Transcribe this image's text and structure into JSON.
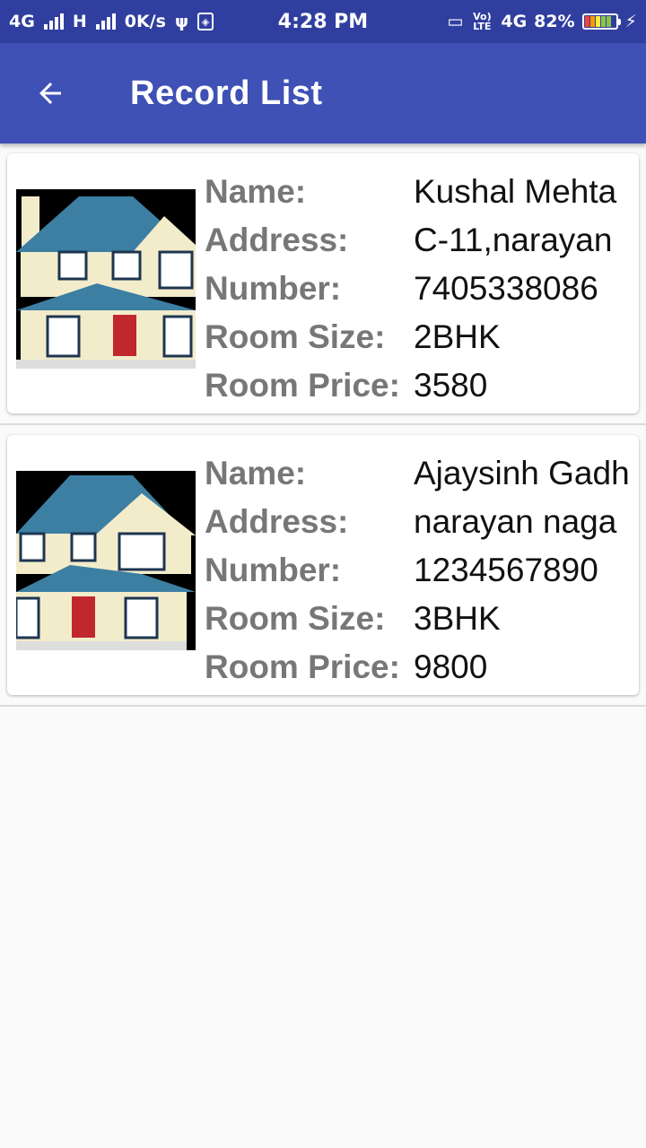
{
  "status_bar": {
    "net1": "4G",
    "net2": "H",
    "speed": "0K/s",
    "time": "4:28 PM",
    "volte": "Vo) LTE",
    "net3": "4G",
    "battery_pct": "82%",
    "battery_level": 0.82
  },
  "app_bar": {
    "title": "Record List",
    "back_icon": "arrow-back-icon"
  },
  "records": [
    {
      "image_icon": "house-image",
      "name_label": "Name:",
      "name": "Kushal Mehta",
      "address_label": "Address:",
      "address": "C-11,narayan",
      "number_label": "Number:",
      "number": "7405338086",
      "room_size_label": "Room Size:",
      "room_size": "2BHK",
      "room_price_label": "Room Price:",
      "room_price": "3580"
    },
    {
      "image_icon": "house-image",
      "name_label": "Name:",
      "name": "Ajaysinh Gadh",
      "address_label": "Address:",
      "address": "narayan naga",
      "number_label": "Number:",
      "number": "1234567890",
      "room_size_label": "Room Size:",
      "room_size": "3BHK",
      "room_price_label": "Room Price:",
      "room_price": "9800"
    }
  ],
  "colors": {
    "status_bar": "#303f9f",
    "app_bar": "#3f51b5",
    "background": "#fafafa",
    "label": "#777777"
  }
}
